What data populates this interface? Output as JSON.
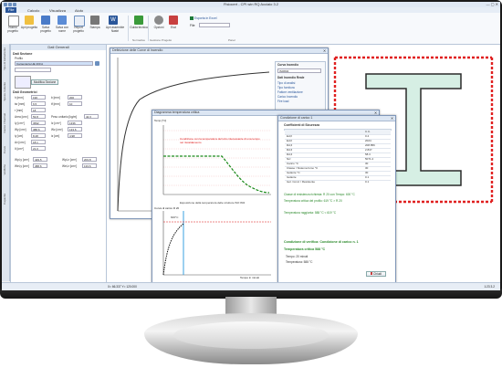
{
  "app": {
    "title": "Fisiocert - CPI win RQ Acciaio 3.2",
    "tabs": [
      "File",
      "Calcolo",
      "Visualizza",
      "Aiuto"
    ],
    "active_tab": "File",
    "colors": {
      "accent": "#2b579a",
      "ribbon": "#f7f9fc",
      "curve_red": "#d11",
      "curve_green": "#1a8a1a",
      "hatch_red": "#e02020",
      "section_fill": "#d6efe4"
    }
  },
  "ribbon": {
    "buttons": [
      {
        "label": "Nuovo progetto",
        "icon": "new-file-icon"
      },
      {
        "label": "Apri progetto",
        "icon": "open-folder-icon"
      },
      {
        "label": "Salva progetto",
        "icon": "save-icon"
      },
      {
        "label": "Salva con nome",
        "icon": "save-as-icon"
      },
      {
        "label": "Report progetto",
        "icon": "report-icon"
      },
      {
        "label": "Stampa",
        "icon": "print-icon"
      },
      {
        "label": "Apri assemble Nastri",
        "icon": "word-icon"
      },
      {
        "label": "Guida tecnica",
        "icon": "help-book-icon"
      },
      {
        "label": "Opzioni",
        "icon": "options-icon"
      },
      {
        "label": "Esci",
        "icon": "exit-icon"
      }
    ],
    "groups": [
      "Normativa",
      "Gestione Progetto",
      "Panel"
    ],
    "right_link": "Esporta in Excel",
    "right_field_label": "File"
  },
  "sidetabs": [
    "Tipo di trattamento",
    "Spess. Isolante",
    "Carico / Normali",
    "Curve",
    "Verifiche",
    "Capacità"
  ],
  "left_panel": {
    "header": "Dati Generali",
    "section1": "Dati Sezione",
    "profilo_label": "Profilo",
    "profilo_value": "Carpenteria HE 200 A",
    "profilo_extra": "",
    "btn_modifica": "Modifica Sezione",
    "section2": "Dati Geometrici",
    "rows": [
      {
        "l": "h [mm]",
        "v": "190",
        "l2": "b [mm]",
        "v2": "200"
      },
      {
        "l": "tw [mm]",
        "v": "6.5",
        "l2": "tf [mm]",
        "v2": "10"
      },
      {
        "l": "r [mm]",
        "v": "18",
        "l2": "",
        "v2": ""
      },
      {
        "l": "Area [cm²]",
        "v": "53.8",
        "l2": "Peso unitario [kg/m]",
        "v2": "42.3"
      },
      {
        "l": "Iy [cm⁴]",
        "v": "3692",
        "l2": "Iz [cm⁴]",
        "v2": "1336"
      },
      {
        "l": "Wy [cm³]",
        "v": "388.6",
        "l2": "Wz [cm³]",
        "v2": "133.6"
      },
      {
        "l": "iy [cm]",
        "v": "8.28",
        "l2": "iz [cm]",
        "v2": "4.98"
      },
      {
        "l": "Av [cm²]",
        "v": "18.1",
        "l2": "",
        "v2": ""
      },
      {
        "l": "It [cm⁴]",
        "v": "21.0",
        "l2": "",
        "v2": ""
      },
      {
        "l": "Wpl,y [cm³]",
        "v": "429.5",
        "l2": "Wpl,z [cm³]",
        "v2": "203.8"
      },
      {
        "l": "Wel,y [cm³]",
        "v": "388.6",
        "l2": "Wel,z [cm³]",
        "v2": "133.6"
      }
    ]
  },
  "win_curve": {
    "title": "Definizione delle Curve di Incendio",
    "side_title": "Curva Incendio",
    "side_select": "ISO834",
    "side_section": "Dati Incendio Reale",
    "side_rows": [
      "Tipo di analisi",
      "Tipo fornitura",
      "Fattore ventilazione",
      "Carico Incendio",
      "Fire load"
    ]
  },
  "win_temp": {
    "title": "Diagramma temperatura critica",
    "ylabel": "Temp [°C]",
    "annotation": "Condizione con la temperatura del tubo interessante di una tempo nel riscaldamento",
    "xlabel": "Esposizione della temperatura delle strutture ISO 834",
    "lower_ylabel": "Curva di carico R 20",
    "lower_xlabel": "Tempo in minuti",
    "lower_val": "600°C",
    "ticks_y": [
      "1000",
      "900",
      "800",
      "700",
      "600",
      "500",
      "400",
      "300",
      "200",
      "100"
    ],
    "ticks_x": [
      "0",
      "0.1",
      "0.2",
      "0.3",
      "0.4",
      "0.5",
      "0.6",
      "0.7",
      "0.8",
      "0.9",
      "1"
    ]
  },
  "win_cond": {
    "select": "Condizione di carico 1",
    "heading": "Coefficienti di Sicurezza",
    "col_value": "C.C.",
    "rows": [
      {
        "k": "Ed,fi",
        "v": "0.4"
      },
      {
        "k": "Ed,fi",
        "v": "2024"
      },
      {
        "k": "Rd,fi",
        "v": "208.856"
      },
      {
        "k": "Rd,fi",
        "v": "2.847"
      },
      {
        "k": "Rd,fi",
        "v": "58.3"
      },
      {
        "k": "Ncr",
        "v": "5071.2"
      },
      {
        "k": "Carico °C",
        "v": "30"
      },
      {
        "k": "Classe / Sistema fumo °C",
        "v": "30"
      },
      {
        "k": "Isolante °C",
        "v": "30"
      },
      {
        "k": "Isolante",
        "v": "0.1"
      },
      {
        "k": "Isol. Cond. / Resistente",
        "v": "0.1"
      }
    ],
    "text1": "Classe di resistenza richiesta: R 20 con Tempo: 600 °C",
    "text2": "Temperatura critica del profilo: 619 °C > R 20",
    "text3": "Temperatura raggiunta: 588 °C < 619 °C",
    "verify": "Condizione di verifica: Condizione di carico n. 1",
    "temp_crit": "Temperatura critica 588 °C",
    "tempo": "Tempo: 20 minuti",
    "temp_sez": "Temperatura: 588 °C",
    "close_btn": "Chiudi"
  },
  "status": {
    "left": "X= 66.337 Y= 120.000",
    "right": "1:23  3.2"
  }
}
